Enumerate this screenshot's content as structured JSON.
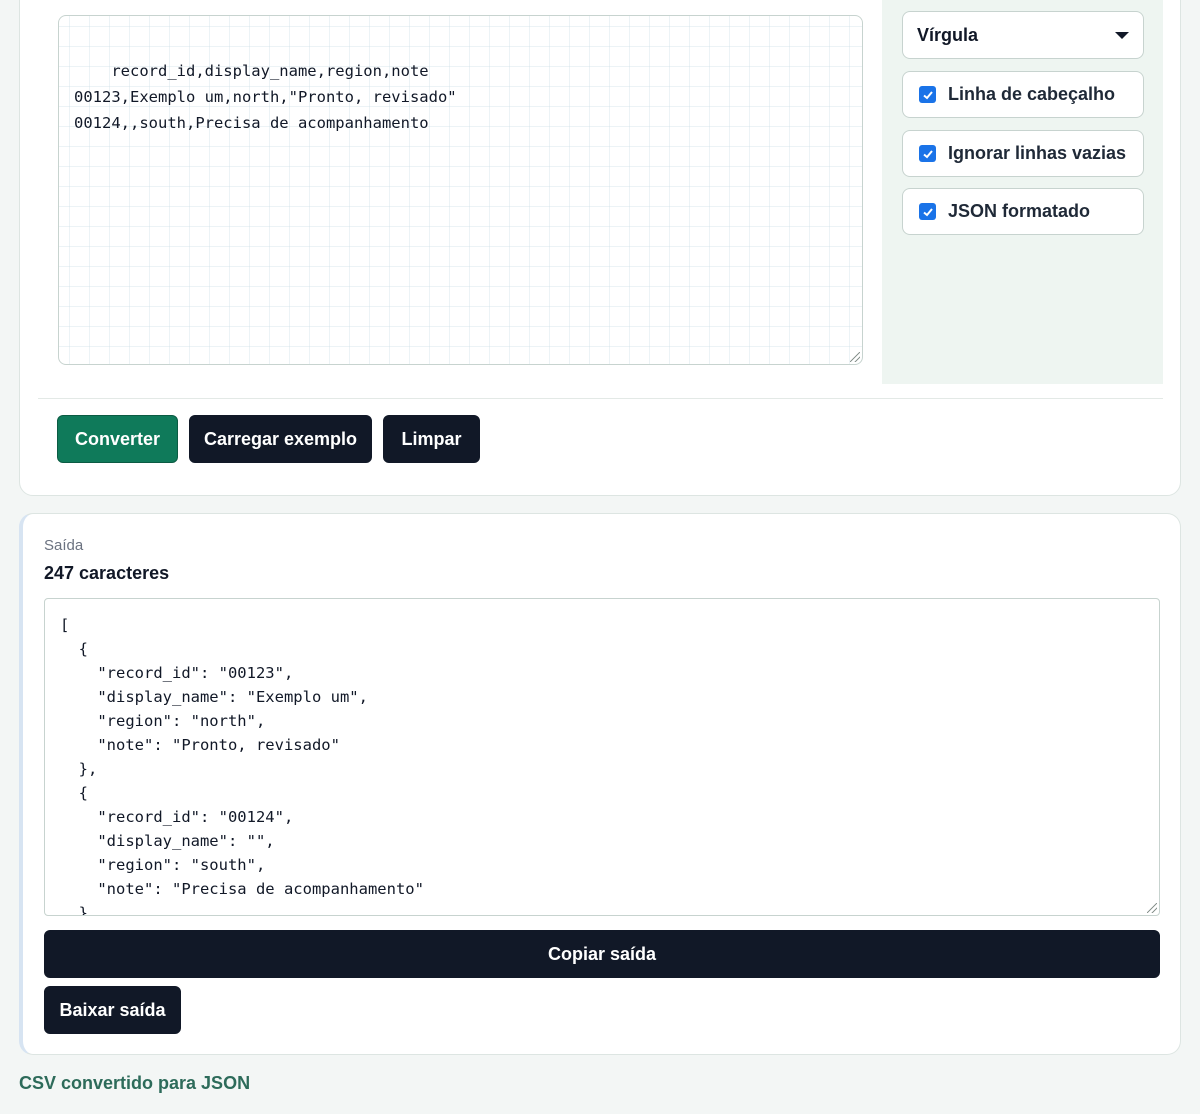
{
  "input": {
    "csv_text": "record_id,display_name,region,note\n00123,Exemplo um,north,\"Pronto, revisado\"\n00124,,south,Precisa de acompanhamento"
  },
  "options": {
    "delimiter_selected": "Vírgula",
    "checkboxes": [
      {
        "label": "Linha de cabeçalho",
        "checked": true
      },
      {
        "label": "Ignorar linhas vazias",
        "checked": true
      },
      {
        "label": "JSON formatado",
        "checked": true
      }
    ]
  },
  "actions": {
    "convert_label": "Converter",
    "load_example_label": "Carregar exemplo",
    "clear_label": "Limpar"
  },
  "output": {
    "label": "Saída",
    "count": "247 caracteres",
    "json_text": "[\n  {\n    \"record_id\": \"00123\",\n    \"display_name\": \"Exemplo um\",\n    \"region\": \"north\",\n    \"note\": \"Pronto, revisado\"\n  },\n  {\n    \"record_id\": \"00124\",\n    \"display_name\": \"\",\n    \"region\": \"south\",\n    \"note\": \"Precisa de acompanhamento\"\n  }\n]",
    "copy_label": "Copiar saída",
    "download_label": "Baixar saída"
  },
  "status": {
    "message": "CSV convertido para JSON"
  },
  "colors": {
    "primary": "#0f7a5a",
    "dark": "#111827",
    "checkbox": "#1a73e8",
    "status": "#2d6b5a"
  },
  "icons": {
    "dropdown": "caret-down-icon",
    "check": "checkmark-icon",
    "resize": "resize-grip-icon"
  }
}
